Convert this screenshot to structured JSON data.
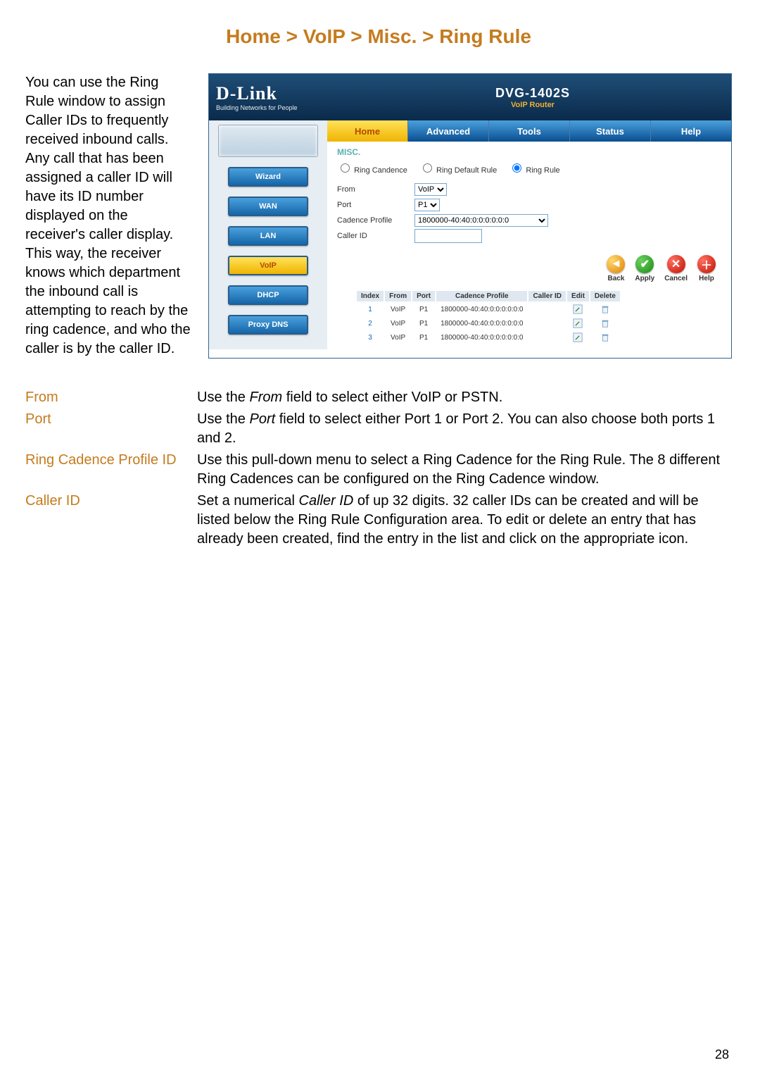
{
  "breadcrumb": "Home > VoIP > Misc. > Ring Rule",
  "intro": "You can use the Ring Rule window to assign Caller IDs to frequently received inbound calls. Any call that has been assigned a caller ID will have its ID number displayed on the receiver's caller display. This way, the receiver knows which department the inbound call is attempting to reach by the ring cadence, and who the caller is by the caller ID.",
  "shot": {
    "brand": "D-Link",
    "brand_tag": "Building Networks for People",
    "model": "DVG-1402S",
    "model_sub": "VoIP Router",
    "tabs": [
      "Home",
      "Advanced",
      "Tools",
      "Status",
      "Help"
    ],
    "active_tab": 0,
    "sidebar": [
      "Wizard",
      "WAN",
      "LAN",
      "VoIP",
      "DHCP",
      "Proxy DNS"
    ],
    "sidebar_active_index": 3,
    "section": "MISC.",
    "radios": {
      "ring_candence": "Ring Candence",
      "ring_default": "Ring Default Rule",
      "ring_rule": "Ring Rule",
      "selected": "ring_rule"
    },
    "form": {
      "from_label": "From",
      "from_value": "VoIP",
      "port_label": "Port",
      "port_value": "P1",
      "cadence_label": "Cadence Profile",
      "cadence_value": "1800000-40:40:0:0:0:0:0:0",
      "caller_label": "Caller ID",
      "caller_value": ""
    },
    "actions": {
      "back": "Back",
      "apply": "Apply",
      "cancel": "Cancel",
      "help": "Help"
    },
    "table": {
      "headers": [
        "Index",
        "From",
        "Port",
        "Cadence Profile",
        "Caller ID",
        "Edit",
        "Delete"
      ],
      "rows": [
        {
          "index": "1",
          "from": "VoIP",
          "port": "P1",
          "cadence": "1800000-40:40:0:0:0:0:0:0",
          "caller": ""
        },
        {
          "index": "2",
          "from": "VoIP",
          "port": "P1",
          "cadence": "1800000-40:40:0:0:0:0:0:0",
          "caller": ""
        },
        {
          "index": "3",
          "from": "VoIP",
          "port": "P1",
          "cadence": "1800000-40:40:0:0:0:0:0:0",
          "caller": ""
        }
      ]
    }
  },
  "defs": [
    {
      "term": "From",
      "body_pre": "Use the ",
      "body_em": "From",
      "body_post": " field to select either VoIP or PSTN."
    },
    {
      "term": "Port",
      "body_pre": "Use the ",
      "body_em": "Port",
      "body_post": " field to select either Port 1 or Port 2. You can also choose both ports 1 and 2."
    },
    {
      "term": "Ring Cadence Profile ID",
      "body_pre": "",
      "body_em": "",
      "body_post": "Use this pull-down menu to select a Ring Cadence for the Ring Rule. The 8 different Ring Cadences can be configured on the Ring Cadence window."
    },
    {
      "term": "Caller ID",
      "body_pre": "Set a numerical ",
      "body_em": "Caller ID",
      "body_post": " of up 32 digits. 32 caller IDs can be created and will be listed below the Ring Rule Configuration area. To edit or delete an entry that has already been created, find the entry in the list and click on the appropriate icon."
    }
  ],
  "page_number": "28"
}
